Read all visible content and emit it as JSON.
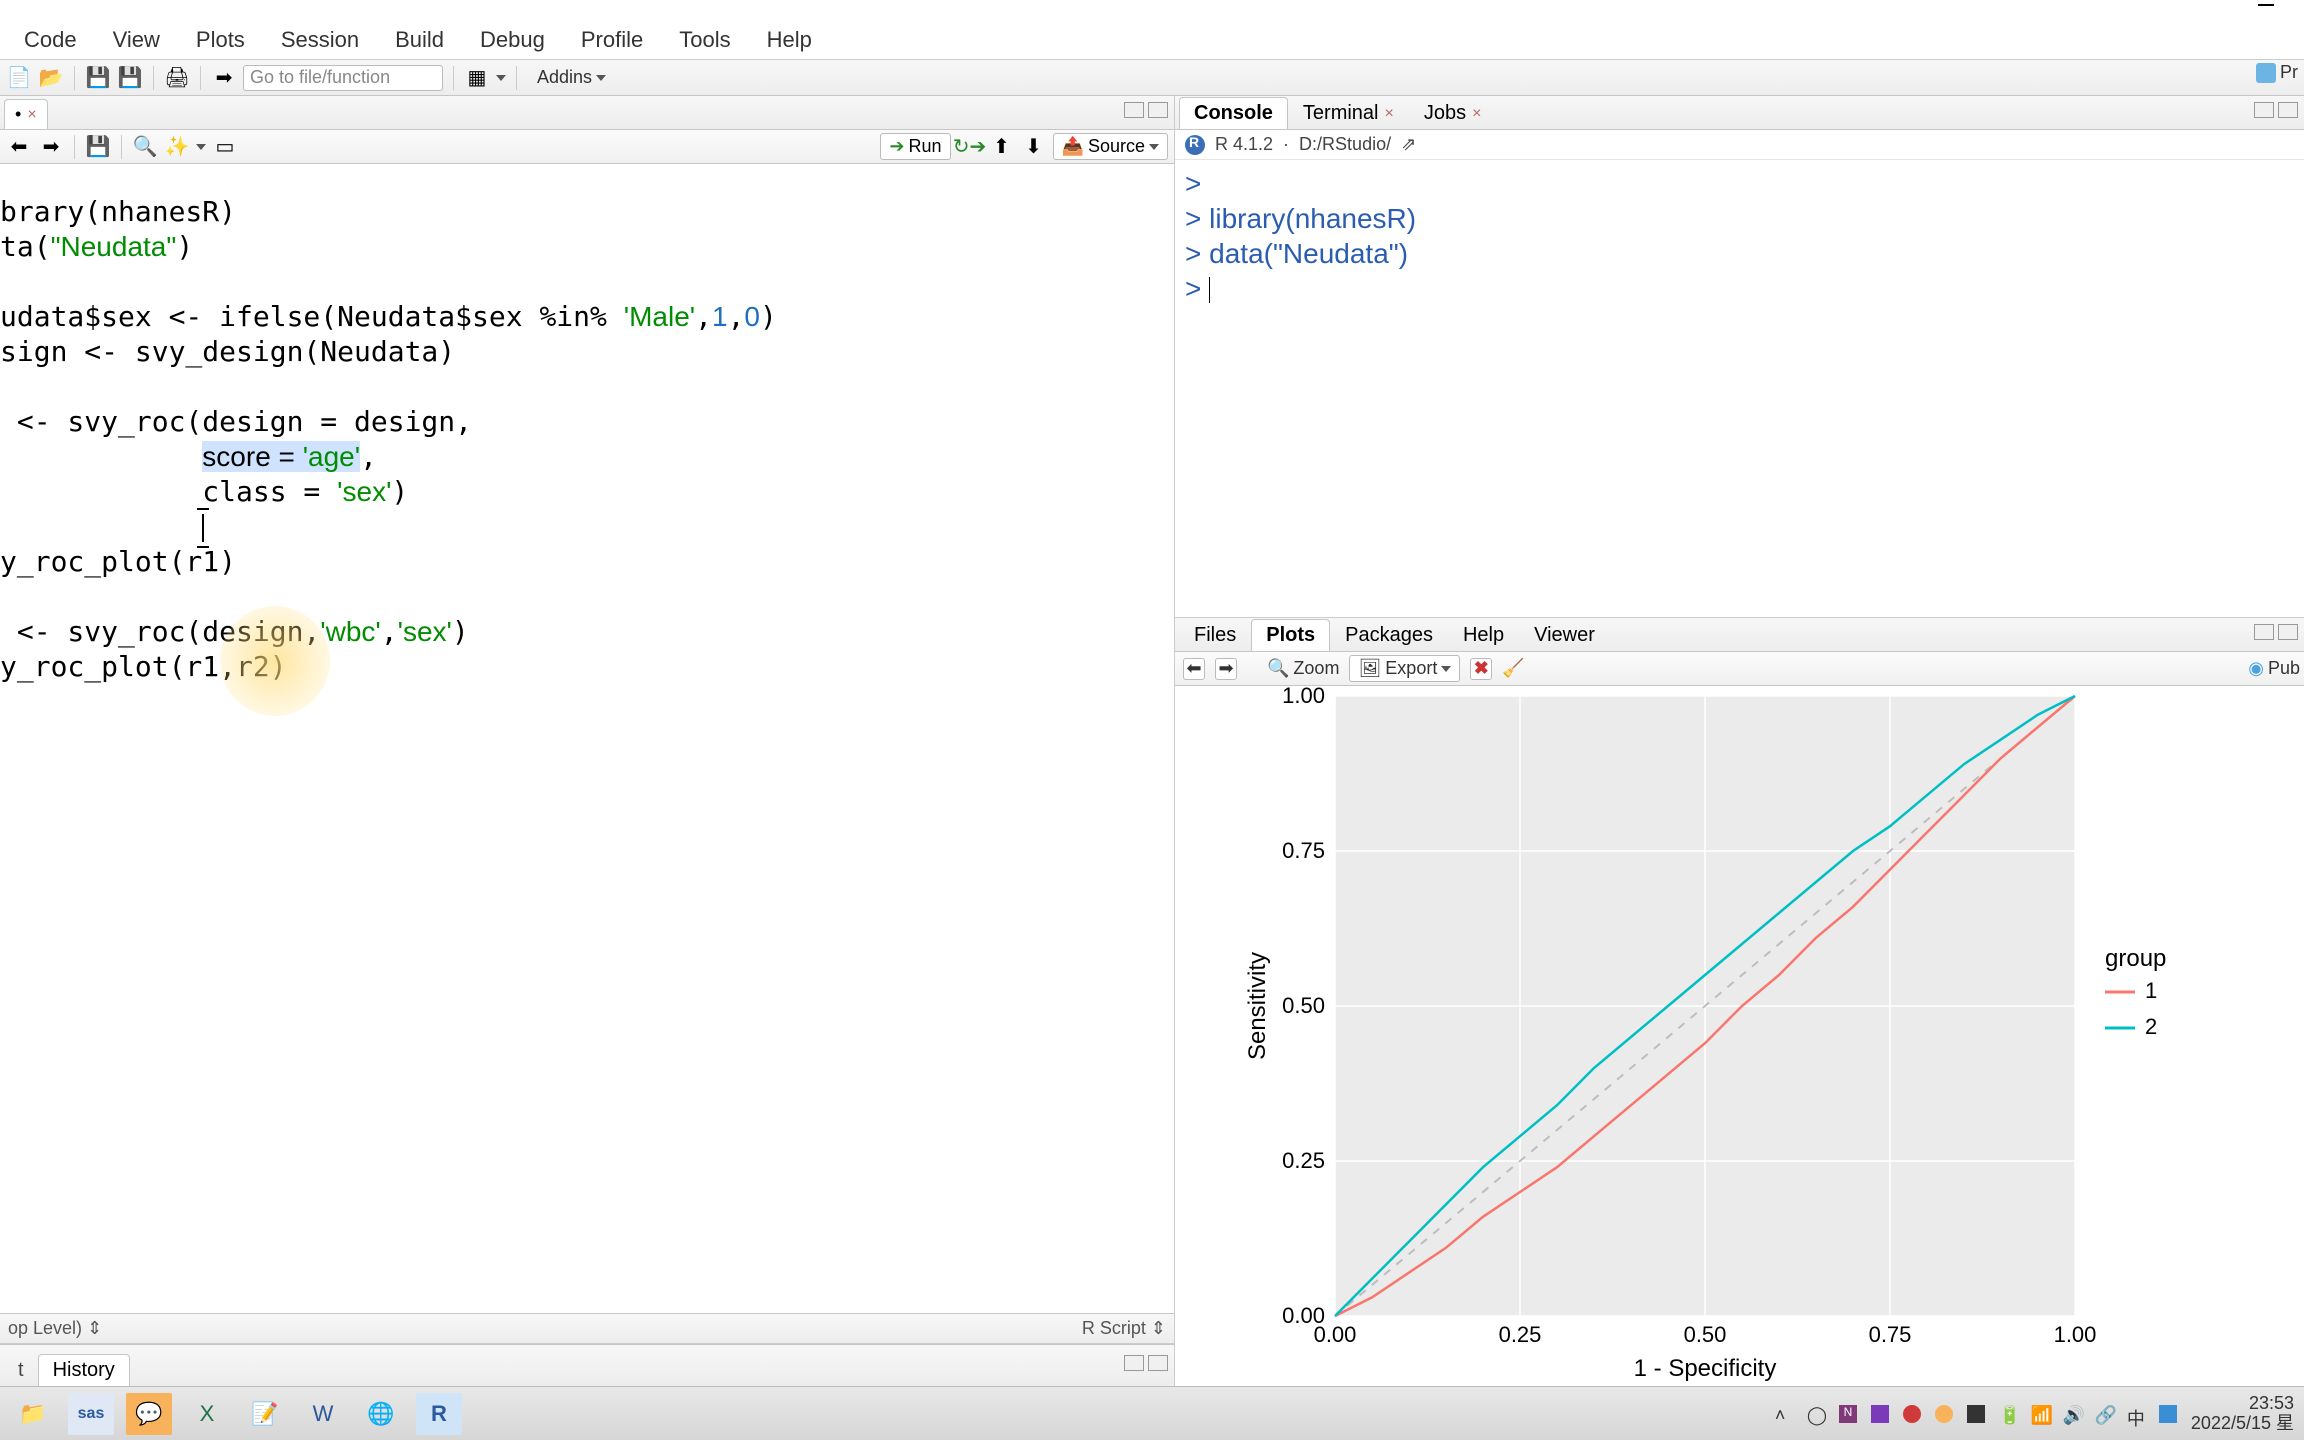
{
  "menu": {
    "items": [
      "Code",
      "View",
      "Plots",
      "Session",
      "Build",
      "Debug",
      "Profile",
      "Tools",
      "Help"
    ]
  },
  "toolbar": {
    "goto_placeholder": "Go to file/function",
    "addins_label": "Addins",
    "project_label": "Pr"
  },
  "source": {
    "tab_close_icon": "×",
    "run_label": "Run",
    "source_label": "Source",
    "status_left": "op Level)",
    "status_right": "R Script",
    "code_lines": [
      {
        "plain_pre": "brary(nhanesR)"
      },
      {
        "plain_pre": "ta(",
        "str": "\"Neudata\"",
        "plain_post": ")"
      },
      {
        "blank": true
      },
      {
        "plain_pre": "udata$sex <- ifelse(Neudata$sex %in% ",
        "str": "'Male'",
        "mid": ",",
        "num": "1",
        "mid2": ",",
        "num2": "0",
        "plain_post": ")"
      },
      {
        "plain_pre": "sign <- svy_design(Neudata)"
      },
      {
        "blank": true
      },
      {
        "plain_pre": " <- svy_roc(design = design,"
      },
      {
        "plain_pre": "            ",
        "sel_pre": "score = ",
        "sel_str": "'age'",
        "plain_post": ","
      },
      {
        "plain_pre": "            class = ",
        "str": "'sex'",
        "plain_post": ")"
      },
      {
        "cursor_line": true
      },
      {
        "plain_pre": "y_roc_plot(r1)"
      },
      {
        "blank": true
      },
      {
        "plain_pre": " <- svy_roc(design,",
        "str": "'wbc'",
        "mid": ",",
        "str2": "'sex'",
        "plain_post": ")"
      },
      {
        "plain_pre": "y_roc_plot(r1,r2)"
      }
    ]
  },
  "history": {
    "tab1": "t",
    "tab2": "History"
  },
  "console": {
    "tabs": [
      "Console",
      "Terminal",
      "Jobs"
    ],
    "r_version": "R 4.1.2",
    "wd": "D:/RStudio/",
    "lines": [
      {
        "p": ">",
        "t": ""
      },
      {
        "p": ">",
        "t": " library(nhanesR)"
      },
      {
        "p": ">",
        "t": " data(\"Neudata\")"
      },
      {
        "p": ">",
        "t": " "
      }
    ]
  },
  "plots": {
    "tabs": [
      "Files",
      "Plots",
      "Packages",
      "Help",
      "Viewer"
    ],
    "zoom_label": "Zoom",
    "export_label": "Export",
    "publish_label": "Pub"
  },
  "chart_data": {
    "type": "line",
    "title": "",
    "xlabel": "1 - Specificity",
    "ylabel": "Sensitivity",
    "xlim": [
      0,
      1
    ],
    "ylim": [
      0,
      1
    ],
    "xticks": [
      0.0,
      0.25,
      0.5,
      0.75,
      1.0
    ],
    "yticks": [
      0.0,
      0.25,
      0.5,
      0.75,
      1.0
    ],
    "legend_title": "group",
    "legend_position": "right",
    "reference_line": {
      "from": [
        0,
        0
      ],
      "to": [
        1,
        1
      ],
      "style": "dashed",
      "color": "#bdbdbd"
    },
    "series": [
      {
        "name": "1",
        "color": "#F8766D",
        "x": [
          0.0,
          0.05,
          0.1,
          0.15,
          0.2,
          0.25,
          0.3,
          0.35,
          0.4,
          0.45,
          0.5,
          0.55,
          0.6,
          0.65,
          0.7,
          0.75,
          0.8,
          0.85,
          0.9,
          0.95,
          1.0
        ],
        "y": [
          0.0,
          0.03,
          0.07,
          0.11,
          0.16,
          0.2,
          0.24,
          0.29,
          0.34,
          0.39,
          0.44,
          0.5,
          0.55,
          0.61,
          0.66,
          0.72,
          0.78,
          0.84,
          0.9,
          0.95,
          1.0
        ]
      },
      {
        "name": "2",
        "color": "#00BFC4",
        "x": [
          0.0,
          0.05,
          0.1,
          0.15,
          0.2,
          0.25,
          0.3,
          0.35,
          0.4,
          0.45,
          0.5,
          0.55,
          0.6,
          0.65,
          0.7,
          0.75,
          0.8,
          0.85,
          0.9,
          0.95,
          1.0
        ],
        "y": [
          0.0,
          0.06,
          0.12,
          0.18,
          0.24,
          0.29,
          0.34,
          0.4,
          0.45,
          0.5,
          0.55,
          0.6,
          0.65,
          0.7,
          0.75,
          0.79,
          0.84,
          0.89,
          0.93,
          0.97,
          1.0
        ]
      }
    ]
  },
  "taskbar": {
    "apps": [
      "file-explorer",
      "sas",
      "wechat",
      "excel",
      "notepad",
      "word",
      "chrome",
      "rstudio"
    ],
    "time": "23:53",
    "date": "2022/5/15 星"
  },
  "colors": {
    "series1": "#F8766D",
    "series2": "#00BFC4",
    "grid": "#ebebeb",
    "ref": "#bdbdbd"
  }
}
